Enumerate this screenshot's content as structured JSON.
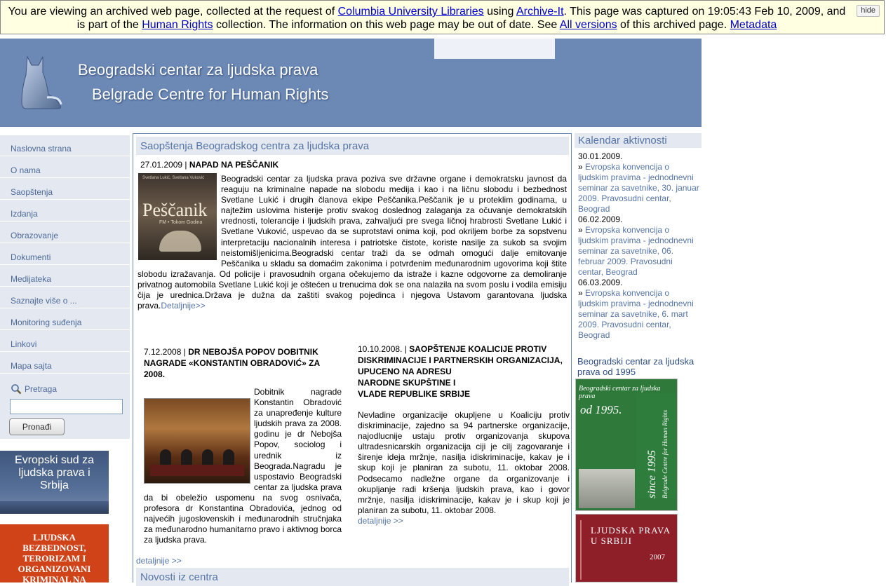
{
  "banner": {
    "text_1": "You are viewing an archived web page, collected at the request of ",
    "link_columbia": "Columbia University Libraries",
    "text_2": " using ",
    "link_archiveit": "Archive-It",
    "text_3": ". This page was captured on 19:05:43 Feb 10, 2009, and is part of the ",
    "link_collection": "Human Rights",
    "text_4": " collection. The information on this web page may be out of date. See ",
    "link_versions": "All versions",
    "text_5": " of this archived page. ",
    "link_metadata": "Metadata",
    "hide_label": "hide"
  },
  "header": {
    "title_sr": "Beogradski centar za ljudska prava",
    "title_en": "Belgrade Centre for Human Rights"
  },
  "nav": {
    "items": [
      "Naslovna strana",
      "O nama",
      "Saopštenja",
      "Izdanja",
      "Obrazovanje",
      "Dokumenti",
      "Medijateka",
      "Saznajte više o ...",
      "Monitoring suđenja",
      "Linkovi",
      "Mapa sajta"
    ],
    "search_label": "Pretraga",
    "search_value": "",
    "search_button": "Pronađi"
  },
  "ads": {
    "court": "Evropski sud za ljudska prava i Srbija",
    "security": "LJUDSKA BEZBEDNOST, TERORIZAM I ORGANIZOVANI KRIMINAL NA ZAPADNOM BALKANU – ANALIZE"
  },
  "main": {
    "section_title": "Saopštenja Beogradskog centra za ljudska prava",
    "lead": {
      "date": "27.01.2009",
      "separator": " | ",
      "title": "NAPAD NA PEŠČANIK",
      "poster_small": "Svetlana Lukić, Svetlana Vuković",
      "poster_title": "Peščanik",
      "poster_sub": "FM • Tokom Godina",
      "text": "Beogradski centar za ljudska prava poziva sve državne organe i demokratsku javnost da reaguju na kriminalne napade na slobodu medija i kao i na ličnu slobodu i bezbednost Svetlane Lukić i drugih članova ekipe Peščanika.Peščanik je u proteklim godinama, u najtežim uslovima histerije protiv svakog doslednog zalaganja za očuvanje demokratskih vrednosti, tolerancije i ljudskih prava, zahvaljući pre svega ličnoj hrabrosti Svetlane Lukić i Svetlane Vuković, uspevao da se suprotstavi onima koji, pod okriljem borbe za sopstvenu interpretaciju nacionalnih interesa i patriotske čistote, koriste nasilje za sukob sa svojim neistomišljenicima.Beogradski centar traži da se odmah omogući dalje emitovanje Peščanika u skladu sa domaćim zakonima i potvrđenim međunarodnim ugovorima koji štite slobodu izražavanja. Od policije i pravosudnih organa očekujemo da istraže i kazne odgovorne za demoliranje privatnog automobila Svetlane Lukić koji je oštećen u trenucima dok se ona nalazila na svom poslu i vodila emisiju čija je urednica.Država je dužna da zaštiti svakog pojedinca i njegova Ustavom garantovana ljudska prava.",
      "more": "Detaljnije>>"
    },
    "news1": {
      "date": "7.12.2008",
      "separator": " | ",
      "title": "DR NEBOJŠA POPOV  DOBITNIK NAGRADE «KONSTANTIN OBRADOVIĆ» ZA 2008.",
      "text": "Dobitnik nagrade Konstantin Obradović za unapređenje kulture ljudskih prava za 2008. godinu je dr Nebojša Popov, sociolog i urednik iz Beograda.Nagradu je uspostavio Beogradski centar za ljudska prava da bi obeležio uspomenu na svog osnivača, profesora dr Konstantina Obradovića, jednog od najvećih jugoslovenskih i međunarodnih stručnjaka za međunarodno humanitarno pravo i aktivnog borca za ljudska prava.",
      "more": "detaljnije >>"
    },
    "news2": {
      "date": "10.10.2008.",
      "separator": " | ",
      "title_lines": [
        "SAOPŠTENJE KOALICIJE PROTIV DISKRIMINACIJE I PARTNERSKIH ORGANIZACIJA,",
        "UPUCENO NA ADRESU",
        "NARODNE SKUPŠTINE I",
        "VLADE REPUBLIKE SRBIJE"
      ],
      "text": "Nevladine organizacije okupljene u Koaliciju protiv diskriminacije, zajedno sa 94 partnerske organizacije, najodlucnije ustaju protiv organizovanja skupova ultradesnicarskih organizacija ciji je cilj zagovaranje i širenje ideja mržnje, nasilja idiskriminacije, kakav je i skup koji je planiran za subotu, 11. oktobar 2008. Podsecamo nadležne organe da organizovanje i okupljanje radi kršenja ljudskih prava, kao i govor mržnje, nasilja idiskriminacije, kakav je i skup koji je planiran za subotu, 11. oktobar 2008.",
      "more": "detaljnije >>"
    },
    "section2_title": "Novosti iz centra"
  },
  "calendar": {
    "title": "Kalendar aktivnosti",
    "entries": [
      {
        "date": "30.01.2009.",
        "arrow": "»",
        "text": "Evropska konvencija o ljudskim pravima - jednodnevni seminar za savetnike, 30. januar 2009. Pravosudni centar, Beograd"
      },
      {
        "date": "06.02.2009.",
        "arrow": "»",
        "text": "Evropska konvencija o ljudskim pravima - jednodnevni seminar za savetnike, 06. februar 2009. Pravosudni centar, Beograd"
      },
      {
        "date": "06.03.2009.",
        "arrow": "»",
        "text": "Evropska konvencija o ljudskim pravima - jednodnevni seminar za savetnike, 6. mart 2009. Pravosudni centar, Beograd"
      }
    ]
  },
  "since": {
    "label": "Beogradski centar za ljudska prava od 1995",
    "book1_top": "Beogradski centar za ljudska prava",
    "book1_year": "od 1995.",
    "book1_vert": "since 1995",
    "book1_vert_small": "Belgrade Centre for Human Rights",
    "book2_title": "LJUDSKA PRAVA U SRBIJI",
    "book2_year": "2007"
  },
  "colors": {
    "header_blue": "#6c89b6",
    "nav_bg": "#e4e8f0",
    "link_blue": "#5675a6",
    "banner_bg": "#ffffe1"
  }
}
